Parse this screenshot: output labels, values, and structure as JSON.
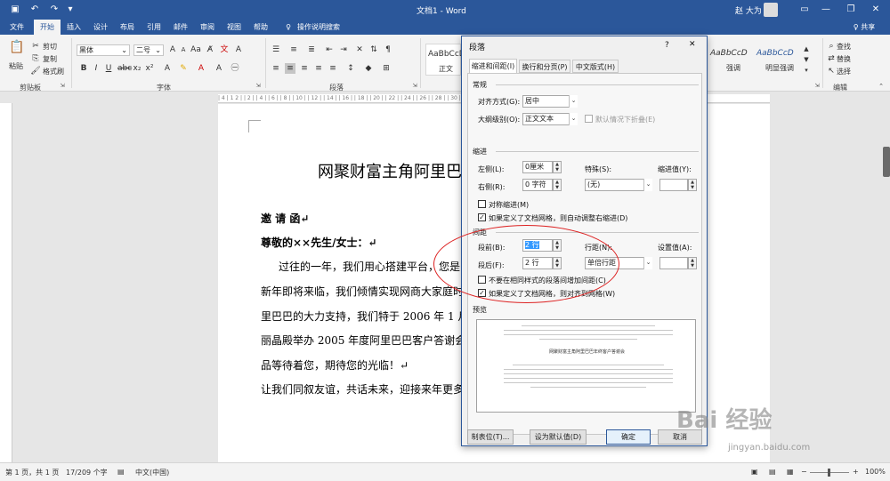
{
  "app": {
    "title": "文档1  -  Word",
    "user": "赵 大为",
    "share": "♀ 共享",
    "quick_access": [
      "save-icon",
      "undo-icon",
      "redo-icon"
    ]
  },
  "tabs": [
    "文件",
    "开始",
    "插入",
    "设计",
    "布局",
    "引用",
    "邮件",
    "审阅",
    "视图",
    "帮助",
    "操作说明搜索"
  ],
  "ribbon": {
    "clipboard": {
      "paste": "粘贴",
      "cut": "剪切",
      "copy": "复制",
      "format_painter": "格式刷",
      "label": "剪贴板"
    },
    "font": {
      "name": "黑体",
      "size": "二号",
      "label": "字体"
    },
    "paragraph": {
      "label": "段落"
    },
    "styles": [
      {
        "preview": "AaBbCcDı",
        "name": "正文"
      },
      {
        "preview": "AaBbCcD",
        "name": "强调"
      },
      {
        "preview": "AaBbCcD",
        "name": "明显强调"
      }
    ],
    "editing": {
      "find": "查找",
      "replace": "替换",
      "select": "选择",
      "label": "编辑"
    }
  },
  "ruler": "| 4 | 1 2 |     | 2 |   | 4 |   | 6 |   | 8 |   | 10 |   | 12 |   | 14 |   | 16 |   | 18 |   | 20 |   | 22 |   | 24 |   | 26 |   | 28 |   | 30 |",
  "document": {
    "title": "网聚财富主角阿里巴",
    "lines": [
      "邀 请 函↵",
      "尊敬的××先生/女士：↵",
      "过往的一年，我们用心搭建平台，您是",
      "新年即将来临，我们倾情实现网商大家庭时",
      "里巴巴的大力支持，我们特于 2006 年 1 月",
      "丽晶殿举办 2005 年度阿里巴巴客户答谢会",
      "品等待着您，期待您的光临！↵",
      "让我们同叙友谊，共话未来，迎接来年更多"
    ]
  },
  "status": {
    "page": "第 1 页，共 1 页",
    "words": "17/209 个字",
    "lang": "中文(中国)",
    "zoom": "100%"
  },
  "dialog": {
    "title": "段落",
    "help": "?",
    "close": "✕",
    "tabs": [
      "缩进和间距(I)",
      "换行和分页(P)",
      "中文版式(H)"
    ],
    "general": {
      "section": "常规",
      "alignment_label": "对齐方式(G):",
      "alignment_value": "居中",
      "outline_label": "大纲级别(O):",
      "outline_value": "正文文本",
      "collapsed_label": "默认情况下折叠(E)"
    },
    "indent": {
      "section": "缩进",
      "left_label": "左侧(L):",
      "left_value": "0厘米",
      "right_label": "右侧(R):",
      "right_value": "0 字符",
      "special_label": "特殊(S):",
      "special_value": "(无)",
      "by_label": "缩进值(Y):",
      "mirror_label": "对称缩进(M)",
      "grid_label": "如果定义了文档网格，则自动调整右缩进(D)"
    },
    "spacing": {
      "section": "间距",
      "before_label": "段前(B):",
      "before_value": "2 行",
      "after_label": "段后(F):",
      "after_value": "2 行",
      "line_label": "行距(N):",
      "line_value": "单倍行距",
      "at_label": "设置值(A):",
      "no_space_label": "不要在相同样式的段落间增加间距(C)",
      "snap_label": "如果定义了文档网格，则对齐到网格(W)"
    },
    "preview": {
      "section": "预览",
      "sample_title": "网聚财富主角阿里巴巴年终客户答谢会"
    },
    "buttons": {
      "tabs": "制表位(T)...",
      "default": "设为默认值(D)",
      "ok": "确定",
      "cancel": "取消"
    }
  },
  "watermark": {
    "brand": "Bai 经验",
    "url": "jingyan.baidu.com"
  }
}
